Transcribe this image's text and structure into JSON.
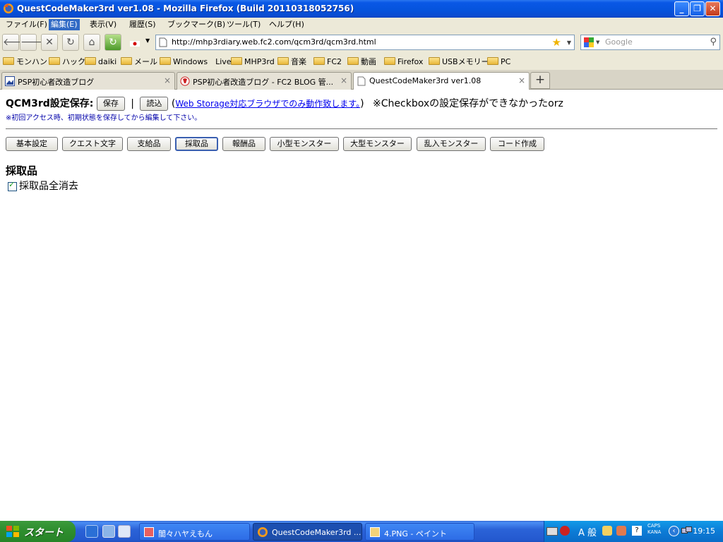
{
  "window": {
    "title": "QuestCodeMaker3rd ver1.08 - Mozilla Firefox (Build 20110318052756)"
  },
  "menu": [
    {
      "label": "ファイル(F)"
    },
    {
      "label": "編集(E)"
    },
    {
      "label": "表示(V)"
    },
    {
      "label": "履歴(S)"
    },
    {
      "label": "ブックマーク(B)"
    },
    {
      "label": "ツール(T)"
    },
    {
      "label": "ヘルプ(H)"
    }
  ],
  "navbar": {
    "url": "http://mhp3rdiary.web.fc2.com/qcm3rd/qcm3rd.html",
    "search_placeholder": "Google"
  },
  "bookmarks": [
    {
      "label": "モンハン"
    },
    {
      "label": "ハック"
    },
    {
      "label": "daiki"
    },
    {
      "label": "メール"
    },
    {
      "label": "Windows　Live"
    },
    {
      "label": "MHP3rd"
    },
    {
      "label": "音楽"
    },
    {
      "label": "FC2"
    },
    {
      "label": "動画"
    },
    {
      "label": "Firefox"
    },
    {
      "label": "USBメモリー"
    },
    {
      "label": "PC"
    }
  ],
  "tabs": [
    {
      "label": "PSP初心者改造ブログ"
    },
    {
      "label": "PSP初心者改造ブログ - FC2 BLOG 管..."
    },
    {
      "label": "QuestCodeMaker3rd ver1.08"
    }
  ],
  "page": {
    "save_label": "QCM3rd設定保存:",
    "save_button": "保存",
    "separator": "|",
    "load_button": "読込",
    "paren_open": "(",
    "storage_link": "Web Storage対応ブラウザでのみ動作致します。",
    "paren_close": ")",
    "orz_note": "※Checkboxの設定保存ができなかったorz",
    "note": "※初回アクセス時、初期状態を保存してから編集して下さい。",
    "tab_buttons": [
      {
        "label": "基本設定"
      },
      {
        "label": "クエスト文字"
      },
      {
        "label": "支給品"
      },
      {
        "label": "採取品"
      },
      {
        "label": "報酬品"
      },
      {
        "label": "小型モンスター"
      },
      {
        "label": "大型モンスター"
      },
      {
        "label": "乱入モンスター"
      },
      {
        "label": "コード作成"
      }
    ],
    "section_title": "採取品",
    "checkbox_label": "採取品全消去",
    "checkbox_checked": true
  },
  "taskbar": {
    "start_label": "スタート",
    "tasks": [
      {
        "label": "闇々ハヤえもん"
      },
      {
        "label": "QuestCodeMaker3rd ..."
      },
      {
        "label": "4.PNG - ペイント"
      }
    ],
    "ime": "A 般",
    "caps": "CAPS",
    "kana": "KANA",
    "clock": "19:15"
  }
}
